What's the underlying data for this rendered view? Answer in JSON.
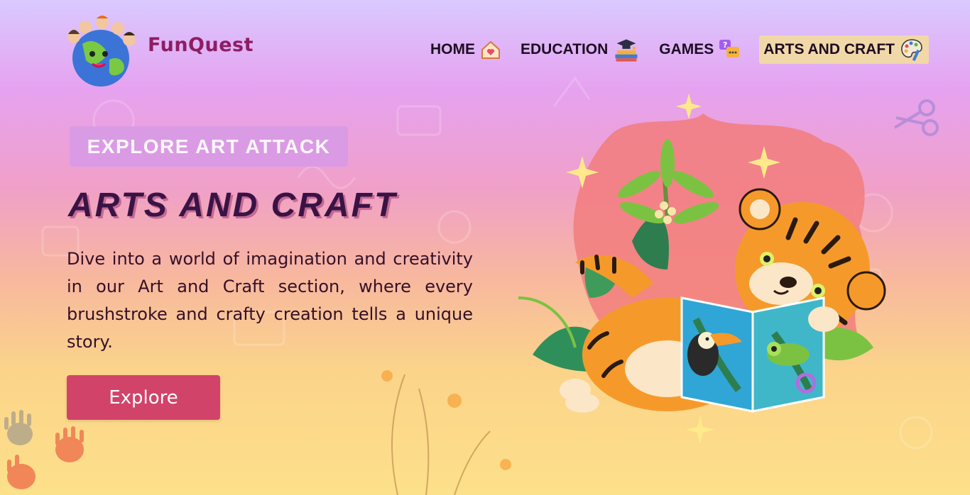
{
  "brand": {
    "name": "FunQuest"
  },
  "nav": {
    "items": [
      {
        "label": "HOME",
        "icon": "home-heart-icon"
      },
      {
        "label": "EDUCATION",
        "icon": "graduation-books-icon"
      },
      {
        "label": "GAMES",
        "icon": "chat-bubbles-icon"
      },
      {
        "label": "ARTS AND CRAFT",
        "icon": "palette-brush-icon",
        "active": true
      }
    ]
  },
  "hero": {
    "eyebrow": "EXPLORE ART ATTACK",
    "title": "ARTS AND CRAFT",
    "description": "Dive into a world of imagination and creativity in our Art and Craft section, where every brushstroke and crafty creation tells a unique story.",
    "button_label": "Explore"
  },
  "colors": {
    "accent": "#d2436a",
    "brand": "#8e1d62",
    "title": "#3a1346",
    "active_nav_bg": "#f1d8a8"
  }
}
